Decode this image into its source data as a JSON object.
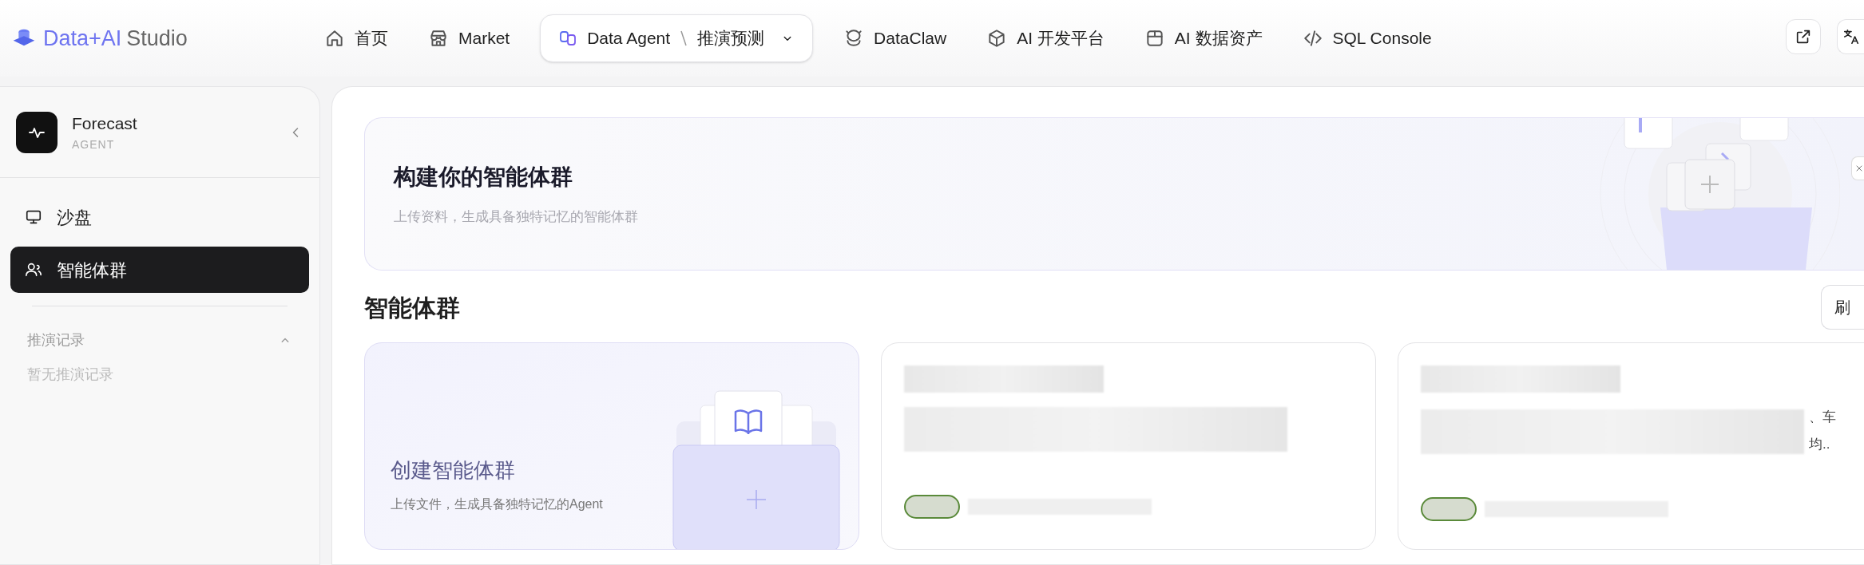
{
  "header": {
    "logo": {
      "brand": "Data+AI",
      "product": "Studio"
    },
    "nav": [
      {
        "kind": "link",
        "label": "首页",
        "selected": false
      },
      {
        "kind": "link",
        "label": "Market",
        "selected": false
      },
      {
        "kind": "switcher",
        "label": "Data Agent",
        "sub": "推演预测",
        "selected": true
      },
      {
        "kind": "link",
        "label": "DataClaw",
        "selected": false
      },
      {
        "kind": "link",
        "label": "AI 开发平台",
        "selected": false
      },
      {
        "kind": "link",
        "label": "AI 数据资产",
        "selected": false
      },
      {
        "kind": "link",
        "label": "SQL Console",
        "selected": false
      }
    ]
  },
  "sidebar": {
    "agent": {
      "name": "Forecast",
      "type": "AGENT"
    },
    "items": [
      {
        "label": "沙盘",
        "selected": false
      },
      {
        "label": "智能体群",
        "selected": true
      }
    ],
    "history": {
      "title": "推演记录",
      "expanded": true,
      "empty_text": "暂无推演记录"
    }
  },
  "banner": {
    "title": "构建你的智能体群",
    "subtitle": "上传资料，生成具备独特记忆的智能体群"
  },
  "section": {
    "title": "智能体群",
    "refresh_button": "刷"
  },
  "create_card": {
    "title": "创建智能体群",
    "subtitle": "上传文件，生成具备独特记忆的Agent"
  },
  "group_cards": [
    {
      "kind": "blurred"
    },
    {
      "kind": "blurred",
      "text_fragments": [
        "、车",
        "均.."
      ]
    }
  ]
}
